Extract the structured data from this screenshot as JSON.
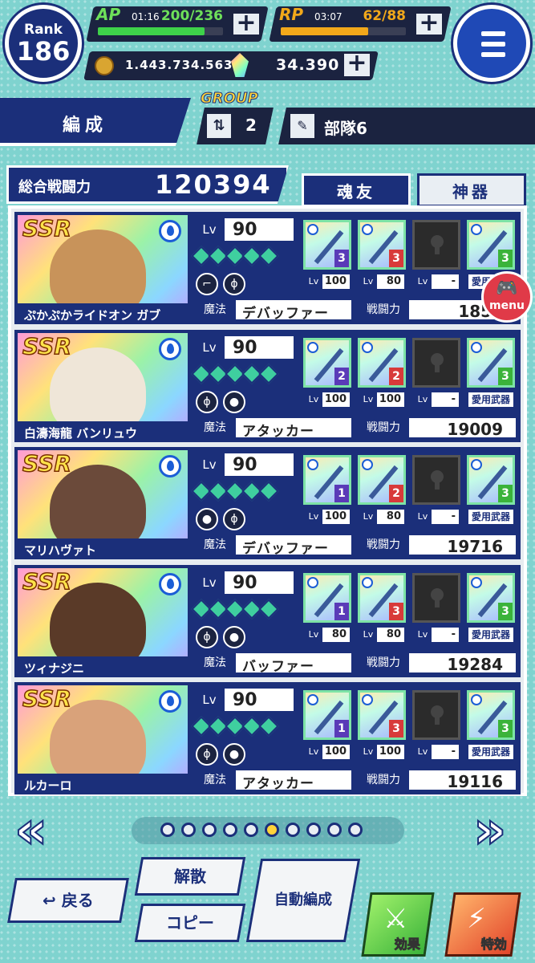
{
  "rank": {
    "label": "Rank",
    "value": "186"
  },
  "ap": {
    "tag": "AP",
    "timer": "01:16",
    "current": "200",
    "max": "236",
    "display": "200/236",
    "fill_pct": 85,
    "color": "#3ed24a"
  },
  "rp": {
    "tag": "RP",
    "timer": "03:07",
    "current": "62",
    "max": "88",
    "display": "62/88",
    "fill_pct": 70,
    "color": "#f2a81a"
  },
  "currency": {
    "gold": "1.443.734.563",
    "gems": "34.390"
  },
  "header": {
    "tab_label": "編成",
    "group_label": "GROUP",
    "group_number": "2",
    "party_name": "部隊6"
  },
  "power": {
    "label": "総合戦闘力",
    "value": "120394"
  },
  "tabs": {
    "active": "魂友",
    "inactive": "神器"
  },
  "level_label": "Lv",
  "magic_label": "魔法",
  "power_label": "戦闘力",
  "favorite_label": "愛用武器",
  "cards": [
    {
      "rarity": "SSR",
      "name": "ぷかぷかライドオン ガブ",
      "level": "90",
      "magic": "デバッファー",
      "power": "1850",
      "portrait_color": "#c8935a",
      "skills": [
        "gun-icon",
        "staff-icon"
      ],
      "equips": [
        {
          "lv": "100",
          "rank": "3",
          "rank_color": "#5a3ab8"
        },
        {
          "lv": "80",
          "rank": "3",
          "rank_color": "#d83a3a"
        },
        {
          "lv": "-",
          "locked": true
        },
        {
          "fav": true,
          "rank": "3",
          "rank_color": "#3bb33a"
        }
      ]
    },
    {
      "rarity": "SSR",
      "name": "白濤海龍 バンリュウ",
      "level": "90",
      "magic": "アタッカー",
      "power": "19009",
      "portrait_color": "#efe6d8",
      "skills": [
        "staff-icon",
        "orb-icon"
      ],
      "equips": [
        {
          "lv": "100",
          "rank": "2",
          "rank_color": "#5a3ab8"
        },
        {
          "lv": "100",
          "rank": "2",
          "rank_color": "#d83a3a"
        },
        {
          "lv": "-",
          "locked": true
        },
        {
          "fav": true,
          "rank": "3",
          "rank_color": "#3bb33a"
        }
      ]
    },
    {
      "rarity": "SSR",
      "name": "マリハヴァト",
      "level": "90",
      "magic": "デバッファー",
      "power": "19716",
      "portrait_color": "#6b4a3a",
      "skills": [
        "orb-icon",
        "staff-icon"
      ],
      "equips": [
        {
          "lv": "100",
          "rank": "1",
          "rank_color": "#5a3ab8"
        },
        {
          "lv": "80",
          "rank": "2",
          "rank_color": "#d83a3a"
        },
        {
          "lv": "-",
          "locked": true
        },
        {
          "fav": true,
          "rank": "3",
          "rank_color": "#3bb33a"
        }
      ]
    },
    {
      "rarity": "SSR",
      "name": "ツィナジニ",
      "level": "90",
      "magic": "バッファー",
      "power": "19284",
      "portrait_color": "#5a3a28",
      "skills": [
        "staff-icon",
        "orb-icon"
      ],
      "equips": [
        {
          "lv": "80",
          "rank": "1",
          "rank_color": "#5a3ab8"
        },
        {
          "lv": "80",
          "rank": "3",
          "rank_color": "#d83a3a"
        },
        {
          "lv": "-",
          "locked": true
        },
        {
          "fav": true,
          "rank": "3",
          "rank_color": "#3bb33a"
        }
      ]
    },
    {
      "rarity": "SSR",
      "name": "ルカーロ",
      "level": "90",
      "magic": "アタッカー",
      "power": "19116",
      "portrait_color": "#d9a27a",
      "skills": [
        "staff-icon",
        "orb-icon"
      ],
      "equips": [
        {
          "lv": "100",
          "rank": "1",
          "rank_color": "#5a3ab8"
        },
        {
          "lv": "100",
          "rank": "3",
          "rank_color": "#d83a3a"
        },
        {
          "lv": "-",
          "locked": true
        },
        {
          "fav": true,
          "rank": "3",
          "rank_color": "#3bb33a"
        }
      ]
    }
  ],
  "float_menu": {
    "label": "menu"
  },
  "pagination": {
    "total": 10,
    "active_index": 5
  },
  "buttons": {
    "back": "戻る",
    "disband": "解散",
    "copy": "コピー",
    "auto": "自動編成",
    "effect": "効果",
    "special": "特効"
  }
}
